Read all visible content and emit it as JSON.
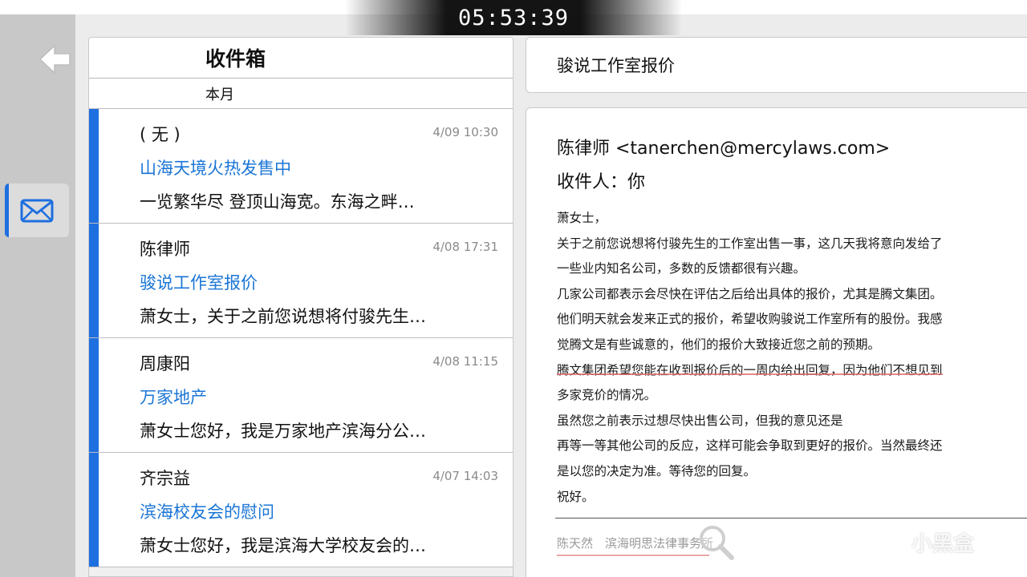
{
  "timer": "05:53:39",
  "nav": {
    "back_icon": "back-arrow-icon",
    "mail_icon": "envelope-icon"
  },
  "inbox": {
    "title": "收件箱",
    "period": "本月",
    "items": [
      {
        "sender": "( 无 )",
        "time": "4/09 10:30",
        "subject": "山海天境火热发售中",
        "preview": "一览繁华尽 登顶山海宽。东海之畔…"
      },
      {
        "sender": "陈律师",
        "time": "4/08 17:31",
        "subject": "骏说工作室报价",
        "preview": "萧女士，关于之前您说想将付骏先生…"
      },
      {
        "sender": "周康阳",
        "time": "4/08 11:15",
        "subject": "万家地产",
        "preview": "萧女士您好，我是万家地产滨海分公…"
      },
      {
        "sender": "齐宗益",
        "time": "4/07 14:03",
        "subject": "滨海校友会的慰问",
        "preview": "萧女士您好，我是滨海大学校友会的…"
      }
    ]
  },
  "message": {
    "subject": "骏说工作室报价",
    "from": "陈律师 <tanerchen@mercylaws.com>",
    "to": "收件人：你",
    "lines": [
      "萧女士，",
      "关于之前您说想将付骏先生的工作室出售一事，这几天我将意向发给了",
      "一些业内知名公司，多数的反馈都很有兴趣。",
      "几家公司都表示会尽快在评估之后给出具体的报价，尤其是腾文集团。",
      "他们明天就会发来正式的报价，希望收购骏说工作室所有的股份。我感",
      "觉腾文是有些诚意的，他们的报价大致接近您之前的预期。",
      "腾文集团希望您能在收到报价后的一周内给出回复，因为他们不想见到",
      "多家竞价的情况。",
      "虽然您之前表示过想尽快出售公司，但我的意见还是",
      "再等一等其他公司的反应，这样可能会争取到更好的报价。当然最终还",
      "是以您的决定为准。等待您的回复。",
      "祝好。"
    ],
    "signature": "陈天然　滨海明思法律事务所"
  },
  "watermark": "小黑盒",
  "colors": {
    "accent": "#1e6fe0",
    "subject_link": "#1a75d6",
    "rail": "#c8c8c8"
  }
}
